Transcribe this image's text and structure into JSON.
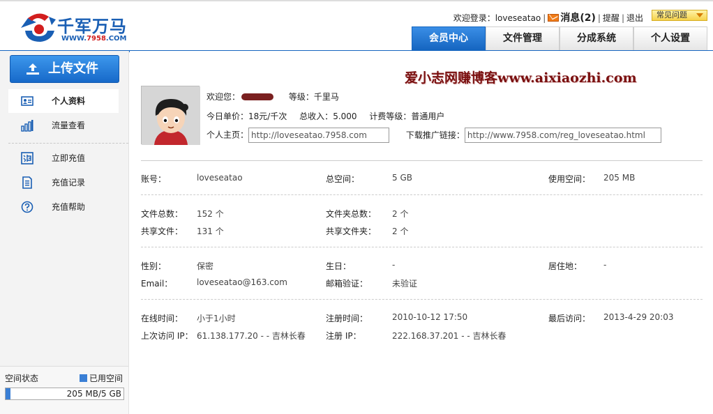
{
  "header": {
    "logo_text": "千军万马",
    "logo_sub_prefix": "WWW.",
    "logo_sub_num": "7958",
    "logo_sub_suffix": ".COM",
    "welcome_label": "欢迎登录：",
    "username": "loveseatao",
    "messages_label": "消息(2)",
    "remind_label": "提醒",
    "logout_label": "退出",
    "faq_label": "常见问题"
  },
  "nav": {
    "tabs": [
      {
        "label": "会员中心",
        "active": true
      },
      {
        "label": "文件管理",
        "active": false
      },
      {
        "label": "分成系统",
        "active": false
      },
      {
        "label": "个人设置",
        "active": false
      }
    ]
  },
  "sidebar": {
    "upload_label": "上传文件",
    "items": [
      {
        "label": "个人资料",
        "icon": "profile-card-icon",
        "active": true
      },
      {
        "label": "流量查看",
        "icon": "bar-chart-icon",
        "active": false
      },
      {
        "label": "立即充值",
        "icon": "recharge-icon",
        "active": false
      },
      {
        "label": "充值记录",
        "icon": "document-icon",
        "active": false
      },
      {
        "label": "充值帮助",
        "icon": "help-icon",
        "active": false
      }
    ],
    "space": {
      "label": "空间状态",
      "legend": "已用空间",
      "text": "205 MB/5 GB",
      "used_fraction": 0.04
    }
  },
  "main": {
    "watermark": "爱小志网赚博客www.aixiaozhi.com",
    "profile": {
      "welcome_label": "欢迎您：",
      "level_label": "等级：",
      "level_value": "千里马",
      "price_label": "今日单价：",
      "price_value": "18元/千次",
      "income_label": "总收入：",
      "income_value": "5.000",
      "billing_label": "计费等级：",
      "billing_value": "普通用户",
      "homepage_label": "个人主页：",
      "homepage_url": "http://loveseatao.7958.com",
      "promo_label": "下载推广链接：",
      "promo_url": "http://www.7958.com/reg_loveseatao.html"
    },
    "account": {
      "account_label": "账号：",
      "account_value": "loveseatao",
      "total_space_label": "总空间：",
      "total_space_value": "5 GB",
      "used_space_label": "使用空间：",
      "used_space_value": "205 MB"
    },
    "files": {
      "total_files_label": "文件总数：",
      "total_files_value": "152 个",
      "total_folders_label": "文件夹总数：",
      "total_folders_value": "2 个",
      "shared_files_label": "共享文件：",
      "shared_files_value": "131 个",
      "shared_folders_label": "共享文件夹：",
      "shared_folders_value": "2 个"
    },
    "personal": {
      "gender_label": "性别：",
      "gender_value": "保密",
      "birthday_label": "生日：",
      "birthday_value": "-",
      "residence_label": "居住地：",
      "residence_value": "-",
      "email_label": "Email：",
      "email_value": "loveseatao@163.com",
      "email_verify_label": "邮箱验证：",
      "email_verify_value": "未验证"
    },
    "activity": {
      "online_label": "在线时间：",
      "online_value": "小于1小时",
      "reg_time_label": "注册时间：",
      "reg_time_value": "2010-10-12 17:50",
      "last_visit_label": "最后访问：",
      "last_visit_value": "2013-4-29 20:03",
      "last_ip_label": "上次访问 IP：",
      "last_ip_value": "61.138.177.20 - - 吉林长春",
      "reg_ip_label": "注册 IP：",
      "reg_ip_value": "222.168.37.201 - - 吉林长春"
    }
  },
  "colors": {
    "brand_blue": "#1565c0",
    "active_tab": "#1a6fd0",
    "watermark": "#7a1010",
    "space_fill": "#3a7fd5"
  }
}
